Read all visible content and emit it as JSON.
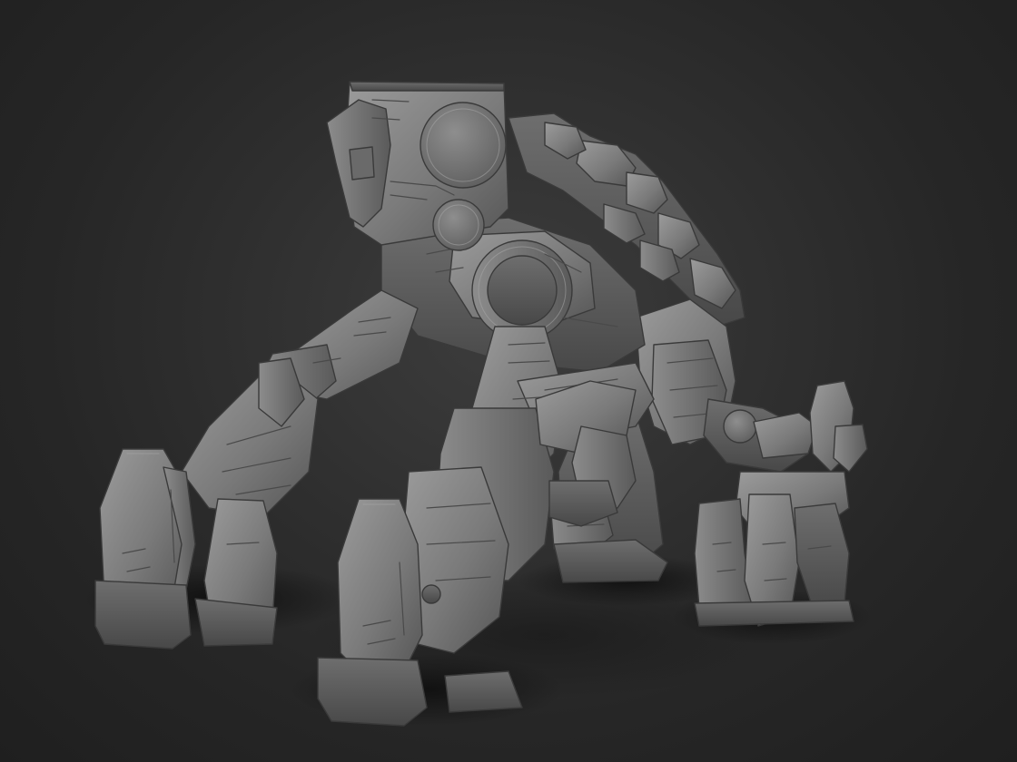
{
  "scene": {
    "subject": "mech-sculpt",
    "colors": {
      "background_center": "#3d3d3d",
      "background_edge": "#1f1f1f",
      "material_light": "#9a9a9a",
      "material_mid": "#787878",
      "material_dark": "#4e4e4e",
      "shadow": "#141414"
    }
  }
}
